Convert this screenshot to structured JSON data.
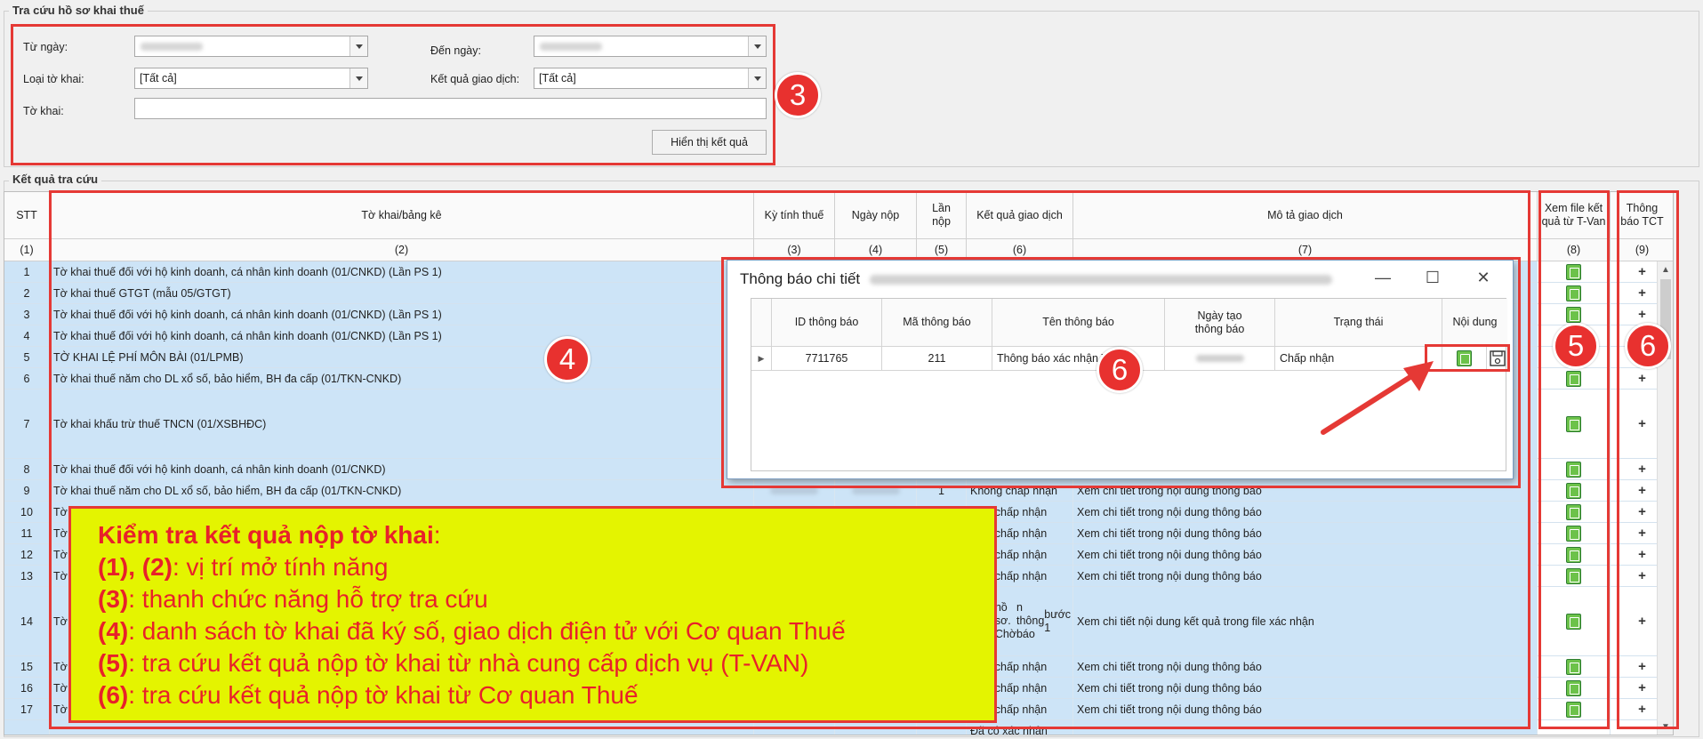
{
  "search": {
    "title": "Tra cứu hồ sơ khai thuế",
    "from_date_label": "Từ ngày:",
    "to_date_label": "Đến ngày:",
    "type_label": "Loại tờ khai:",
    "type_value": "[Tất cả]",
    "result_label": "Kết quả giao dịch:",
    "result_value": "[Tất cả]",
    "declaration_label": "Tờ khai:",
    "declaration_value": "",
    "show_button": "Hiển thị kết quả"
  },
  "results": {
    "title": "Kết quả tra cứu",
    "headers": {
      "stt": "STT",
      "declaration": "Tờ khai/bảng kê",
      "period": "Kỳ tính thuế",
      "submit_date": "Ngày nộp",
      "times": "Lần nộp",
      "tx_result": "Kết quả giao dịch",
      "tx_desc": "Mô tả giao dịch",
      "tvan": "Xem file kết quả từ T-Van",
      "tct": "Thông báo TCT"
    },
    "subheaders": [
      "(1)",
      "(2)",
      "(3)",
      "(4)",
      "(5)",
      "(6)",
      "(7)",
      "(8)",
      "(9)"
    ],
    "rows": [
      {
        "stt": "1",
        "name": "Tờ khai thuế đối với hộ kinh doanh, cá nhân kinh doanh (01/CNKD) (Lần PS 1)",
        "times": "",
        "result": "",
        "desc": ""
      },
      {
        "stt": "2",
        "name": "Tờ khai thuế GTGT (mẫu 05/GTGT)",
        "times": "",
        "result": "",
        "desc": ""
      },
      {
        "stt": "3",
        "name": "Tờ khai thuế đối với hộ kinh doanh, cá nhân kinh doanh (01/CNKD) (Lần PS 1)",
        "times": "",
        "result": "",
        "desc": ""
      },
      {
        "stt": "4",
        "name": "Tờ khai thuế đối với hộ kinh doanh, cá nhân kinh doanh (01/CNKD) (Lần PS 1)",
        "times": "",
        "result": "",
        "desc": ""
      },
      {
        "stt": "5",
        "name": "TỜ KHAI LỆ PHÍ MÔN BÀI (01/LPMB)",
        "times": "",
        "result": "",
        "desc": ""
      },
      {
        "stt": "6",
        "name": "Tờ khai thuế năm cho DL xổ số, bảo hiểm, BH đa cấp (01/TKN-CNKD)",
        "times": "",
        "result": "",
        "desc": ""
      },
      {
        "stt": "7",
        "name": "Tờ khai khấu trừ thuế TNCN (01/XSBHĐC)",
        "times": "",
        "result": "",
        "desc": ""
      },
      {
        "stt": "8",
        "name": "Tờ khai thuế đối với hộ kinh doanh, cá nhân kinh doanh (01/CNKD)",
        "times": "",
        "result": "",
        "desc": ""
      },
      {
        "stt": "9",
        "name": "Tờ khai thuế năm cho DL xổ số, bảo hiểm, BH đa cấp (01/TKN-CNKD)",
        "times": "1",
        "result": "Không chấp nhận",
        "desc": "Xem chi tiết trong nội dung thông báo"
      },
      {
        "stt": "10",
        "name": "Tờ",
        "times": "",
        "result": "...ng chấp nhận",
        "desc": "Xem chi tiết trong nội dung thông báo"
      },
      {
        "stt": "11",
        "name": "Tờ",
        "times": "",
        "result": "...ng chấp nhận",
        "desc": "Xem chi tiết trong nội dung thông báo"
      },
      {
        "stt": "12",
        "name": "Tờ",
        "times": "",
        "result": "...ng chấp nhận",
        "desc": "Xem chi tiết trong nội dung thông báo"
      },
      {
        "stt": "13",
        "name": "Tờ",
        "times": "",
        "result": "...ng chấp nhận",
        "desc": "Xem chi tiết trong nội dung thông báo"
      },
      {
        "stt": "14",
        "name": "Tờ",
        "times": "",
        "result": "...có xác nhận / ...hồ sơ. Chờ / ...n thông báo / ...bước 1",
        "desc": "Xem chi tiết nội dung kết quả trong file xác nhận"
      },
      {
        "stt": "15",
        "name": "Tờ",
        "times": "",
        "result": "...ng chấp nhận",
        "desc": "Xem chi tiết trong nội dung thông báo"
      },
      {
        "stt": "16",
        "name": "Tờ",
        "times": "",
        "result": "...ng chấp nhận",
        "desc": "Xem chi tiết trong nội dung thông báo"
      },
      {
        "stt": "17",
        "name": "Tờ",
        "times": "",
        "result": "...ng chấp nhận",
        "desc": "Xem chi tiết trong nội dung thông báo"
      },
      {
        "stt": "",
        "name": "",
        "times": "",
        "result": "Đã có xác nhận",
        "desc": ""
      }
    ]
  },
  "dialog": {
    "title": "Thông báo chi tiết",
    "headers": {
      "id": "ID thông báo",
      "code": "Mã thông báo",
      "name": "Tên thông báo",
      "created": "Ngày tạo thông báo",
      "status": "Trạng thái",
      "content": "Nội dung"
    },
    "row": {
      "id": "7711765",
      "code": "211",
      "name": "Thông báo xác nhận TC",
      "status": "Chấp nhận"
    }
  },
  "badges": {
    "b3": "3",
    "b4": "4",
    "b5": "5",
    "b6a": "6",
    "b6b": "6"
  },
  "note": {
    "title": "Kiểm tra kết quả nộp tờ khai",
    "title_suffix": ":",
    "lines": [
      {
        "key": "(1), (2)",
        "text": ": vị trí mở tính năng"
      },
      {
        "key": "(3)",
        "text": ": thanh chức năng hỗ trợ tra cứu"
      },
      {
        "key": "(4)",
        "text": ": danh sách tờ khai đã ký số, giao dịch điện tử với Cơ quan Thuế"
      },
      {
        "key": "(5)",
        "text": ": tra cứu kết quả nộp tờ khai từ nhà cung cấp dịch vụ (T-VAN)"
      },
      {
        "key": "(6)",
        "text": ": tra cứu kết quả nộp tờ khai từ Cơ quan Thuế"
      }
    ]
  },
  "colors": {
    "annotation_red": "#e53935",
    "note_yellow": "#e4f400",
    "selected_row": "#cde4f7"
  }
}
